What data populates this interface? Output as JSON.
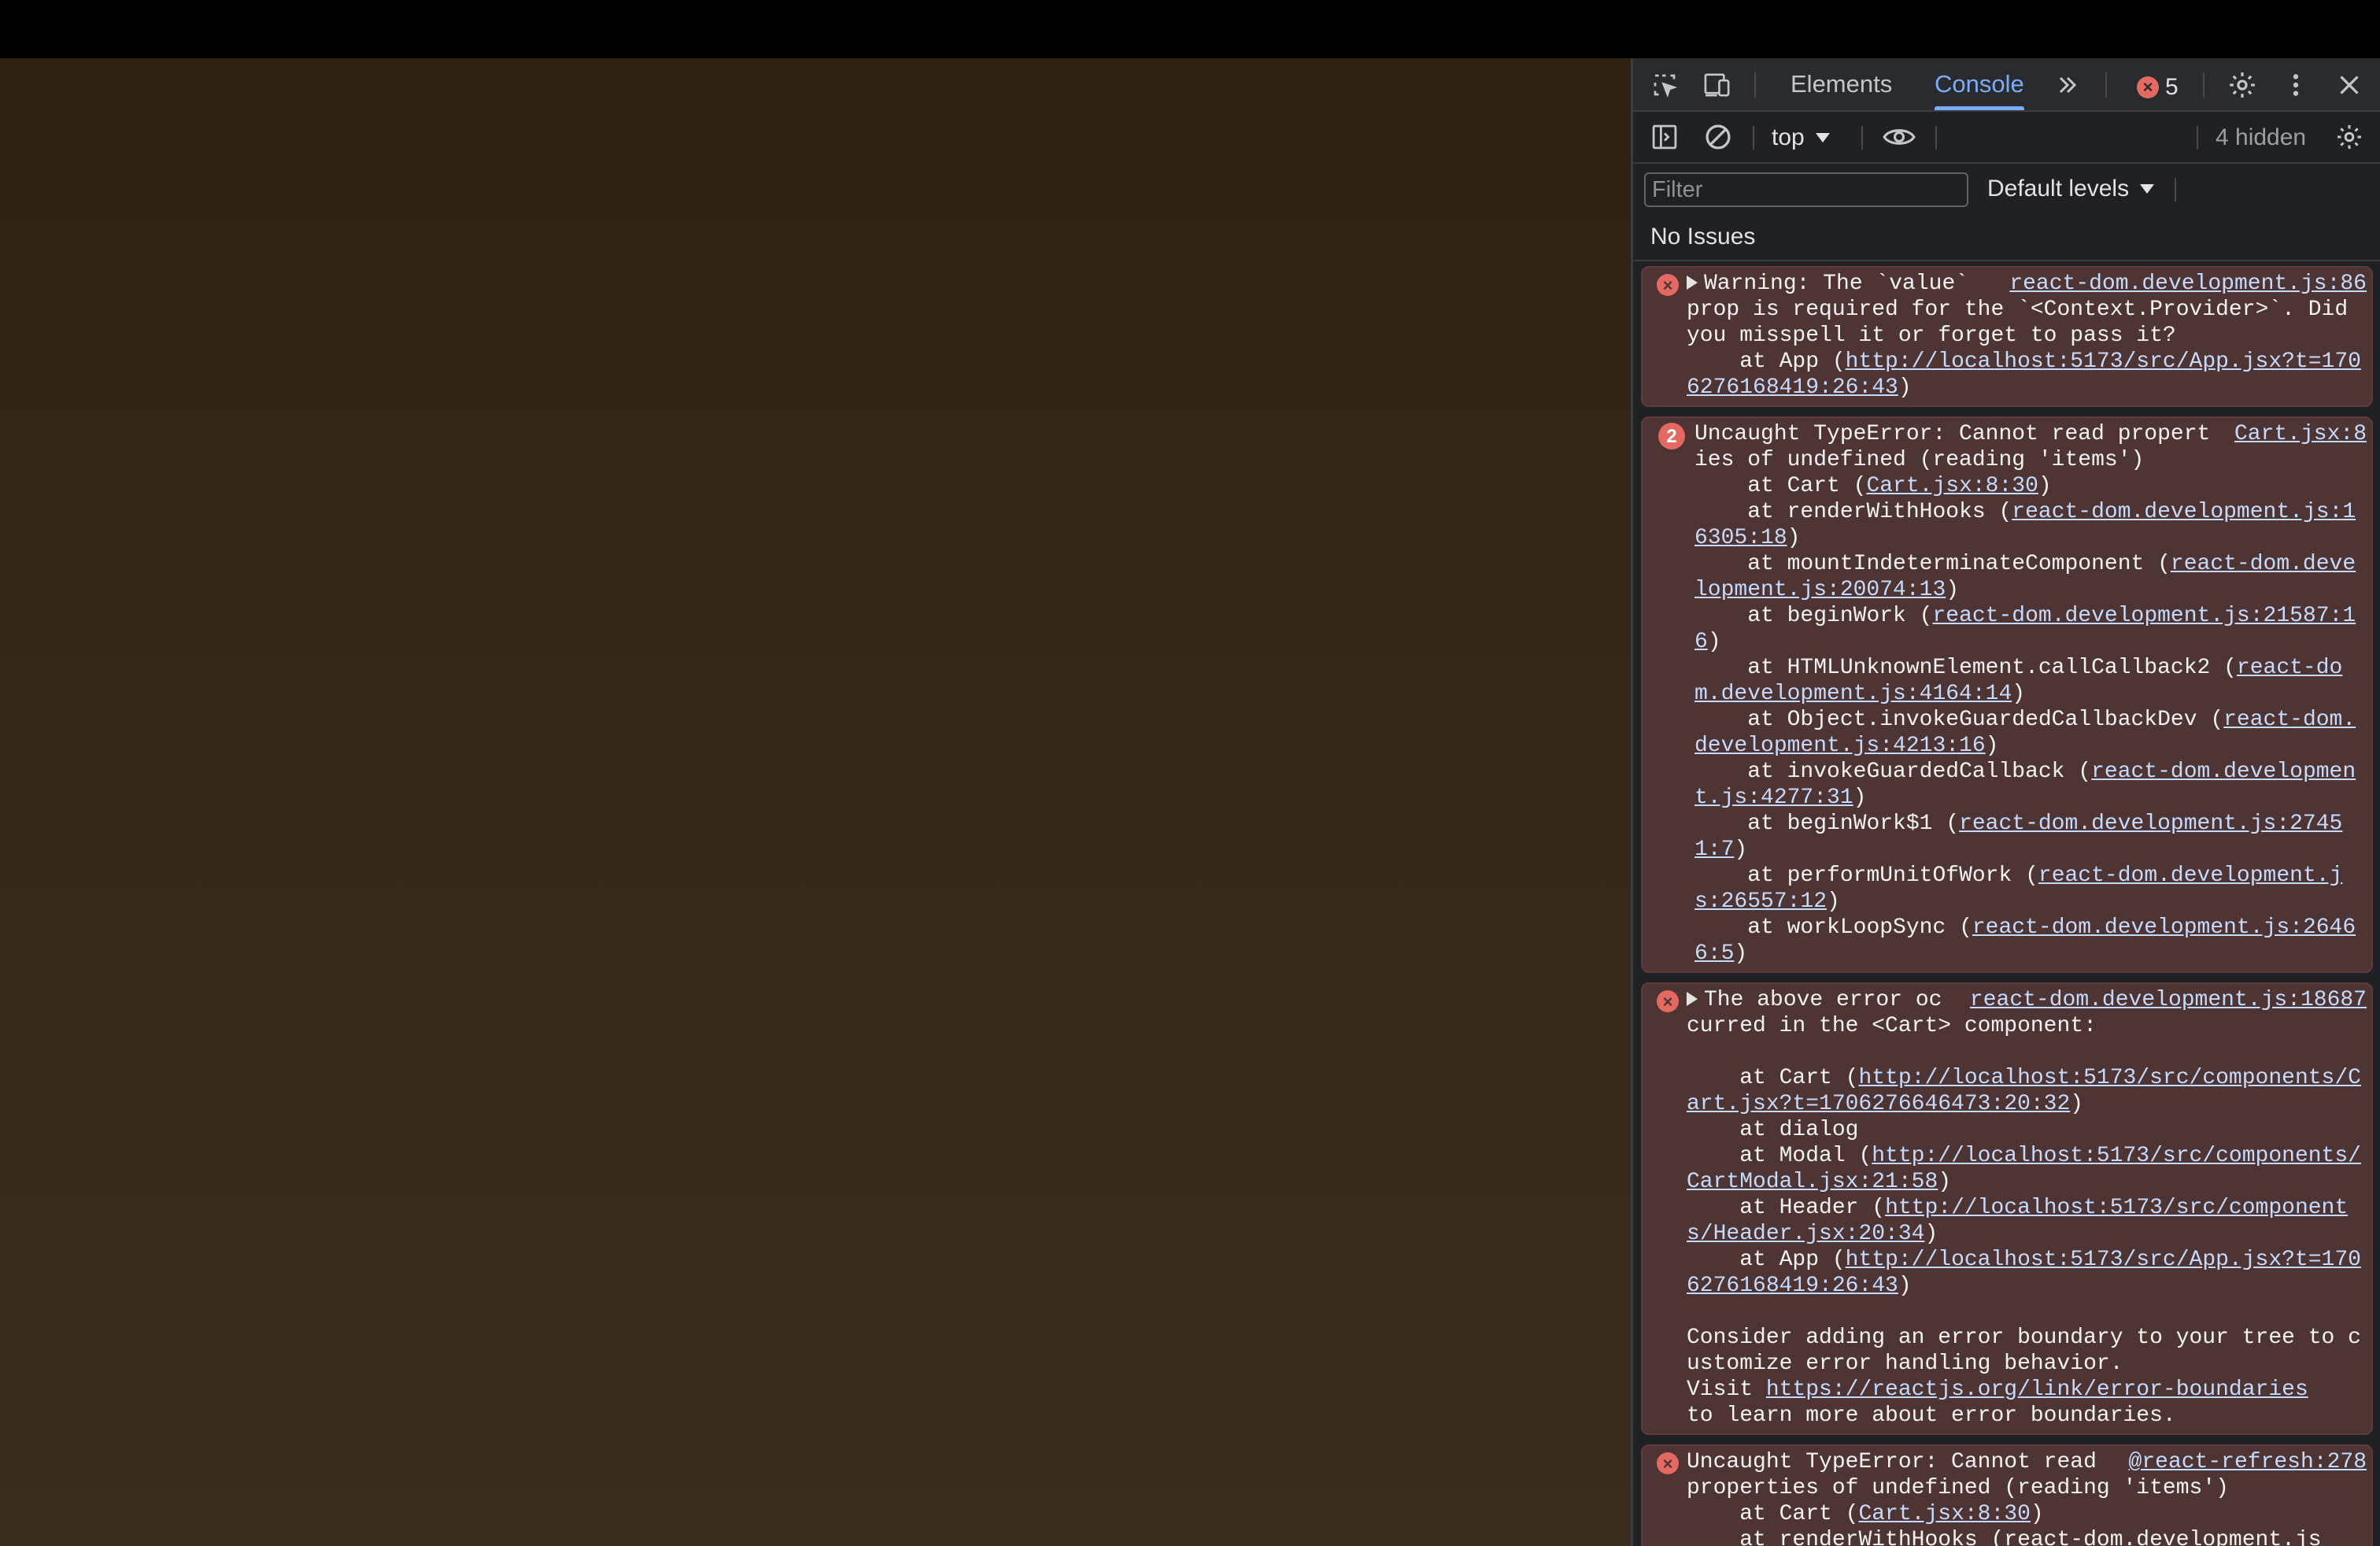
{
  "devtools": {
    "tabs": {
      "elements": "Elements",
      "console": "Console"
    },
    "error_count": "5",
    "context": "top",
    "hidden": "4 hidden",
    "filter_placeholder": "Filter",
    "levels": "Default levels",
    "issues": "No Issues"
  },
  "messages": [
    {
      "source": "react-dom.development.js:86",
      "text": "Warning: The `value` prop is required for the `<Context.Provider>`. Did you misspell it or forget to pass it?\n    at App (",
      "link": "http://localhost:5173/src/App.jsx?t=1706276168419:26:43",
      "tail": ")"
    },
    {
      "count": "2",
      "source": "Cart.jsx:8",
      "head": "Uncaught TypeError: Cannot read properties of undefined (reading 'items')",
      "frames": [
        {
          "pre": "    at Cart (",
          "link": "Cart.jsx:8:30"
        },
        {
          "pre": "    at renderWithHooks (",
          "link": "react-dom.development.js:16305:18"
        },
        {
          "pre": "    at mountIndeterminateComponent (",
          "link": "react-dom.development.js:20074:13"
        },
        {
          "pre": "    at beginWork (",
          "link": "react-dom.development.js:21587:16"
        },
        {
          "pre": "    at HTMLUnknownElement.callCallback2 (",
          "link": "react-dom.development.js:4164:14"
        },
        {
          "pre": "    at Object.invokeGuardedCallbackDev (",
          "link": "react-dom.development.js:4213:16"
        },
        {
          "pre": "    at invokeGuardedCallback (",
          "link": "react-dom.development.js:4277:31"
        },
        {
          "pre": "    at beginWork$1 (",
          "link": "react-dom.development.js:27451:7"
        },
        {
          "pre": "    at performUnitOfWork (",
          "link": "react-dom.development.js:26557:12"
        },
        {
          "pre": "    at workLoopSync (",
          "link": "react-dom.development.js:26466:5"
        }
      ]
    },
    {
      "source": "react-dom.development.js:18687",
      "head": "The above error occurred in the <Cart> component:",
      "frames": [
        {
          "pre": "    at Cart (",
          "link": "http://localhost:5173/src/components/Cart.jsx?t=1706276646473:20:32",
          "post": ")"
        },
        {
          "pre": "    at dialog",
          "link": "",
          "post": ""
        },
        {
          "pre": "    at Modal (",
          "link": "http://localhost:5173/src/components/CartModal.jsx:21:58",
          "post": ")"
        },
        {
          "pre": "    at Header (",
          "link": "http://localhost:5173/src/components/Header.jsx:20:34",
          "post": ")"
        },
        {
          "pre": "    at App (",
          "link": "http://localhost:5173/src/App.jsx?t=1706276168419:26:43",
          "post": ")"
        }
      ],
      "advice": "Consider adding an error boundary to your tree to customize error handling behavior.",
      "visit": "Visit ",
      "visit_link": "https://reactjs.org/link/error-boundaries",
      "learn": "to learn more about error boundaries."
    },
    {
      "source": "@react-refresh:278",
      "head": "Uncaught TypeError: Cannot read properties of undefined (reading 'items')",
      "frame_pre": "    at Cart (",
      "frame_link": "Cart.jsx:8:30",
      "frame_post": ")",
      "partial": "    at renderWithHooks (react-dom.development.js"
    }
  ]
}
